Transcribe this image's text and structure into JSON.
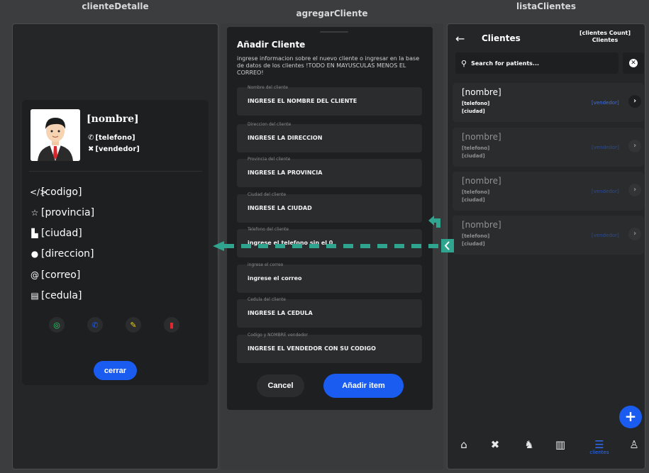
{
  "columns": {
    "detalle": "clienteDetalle",
    "agregar": "agregarCliente",
    "lista": "listaClientes"
  },
  "detalle": {
    "nombre": "[nombre]",
    "telefono": "[telefono]",
    "vendedor": "[vendedor]",
    "fields": {
      "codigo": "[codigo]",
      "provincia": "[provincia]",
      "ciudad": "[ciudad]",
      "direccion": "[direccion]",
      "correo": "[correo]",
      "cedula": "[cedula]"
    },
    "actions": [
      "whatsapp-icon",
      "phone-icon",
      "edit-icon",
      "delete-icon"
    ],
    "cerrar_label": "cerrar"
  },
  "agregar": {
    "title": "Añadir Cliente",
    "description": "ingrese informacion sobre el nuevo cliente o ingresar en la base de datos de los clientes !TODO EN MAYUSCULAS MENOS EL CORREO!",
    "fields": [
      {
        "label": "Nombre del cliente",
        "placeholder": "INGRESE EL NOMBRE DEL CLIENTE"
      },
      {
        "label": "Direccion del cliente",
        "placeholder": "INGRESE LA DIRECCION"
      },
      {
        "label": "Provincia del cliente",
        "placeholder": "INGRESE LA PROVINCIA"
      },
      {
        "label": "Ciudad del cliente",
        "placeholder": "INGRESE LA CIUDAD"
      },
      {
        "label": "Telefono del cliente",
        "placeholder": "ingrese el telefono sin el 0"
      },
      {
        "label": "ingrese el correo",
        "placeholder": "ingrese el correo"
      },
      {
        "label": "Cedula del cliente",
        "placeholder": "INGRESE LA CEDULA"
      },
      {
        "label": "Codigo y NOMBRE vendedor",
        "placeholder": "INGRESE EL VENDEDOR CON SU CODIGO"
      }
    ],
    "cancel_label": "Cancel",
    "add_label": "Añadir item"
  },
  "lista": {
    "title": "Clientes",
    "count_line1": "[clientes Count]",
    "count_line2": "Clientes",
    "search_placeholder": "Search for patients...",
    "items": [
      {
        "nombre": "[nombre]",
        "telefono": "[telefono]",
        "ciudad": "[ciudad]",
        "vendedor": "[vendedor]"
      },
      {
        "nombre": "[nombre]",
        "telefono": "[telefono]",
        "ciudad": "[ciudad]",
        "vendedor": "[vendedor]"
      },
      {
        "nombre": "[nombre]",
        "telefono": "[telefono]",
        "ciudad": "[ciudad]",
        "vendedor": "[vendedor]"
      },
      {
        "nombre": "[nombre]",
        "telefono": "[telefono]",
        "ciudad": "[ciudad]",
        "vendedor": "[vendedor]"
      }
    ],
    "nav": [
      {
        "icon": "home-icon"
      },
      {
        "icon": "tools-icon"
      },
      {
        "icon": "cow-icon"
      },
      {
        "icon": "map-icon"
      },
      {
        "icon": "list-icon",
        "label": "clientes"
      },
      {
        "icon": "person-icon"
      }
    ]
  },
  "colors": {
    "accent": "#1a5cf0",
    "connector": "#2fa58f",
    "background": "#3b3d3f",
    "card": "#1d1f21"
  }
}
